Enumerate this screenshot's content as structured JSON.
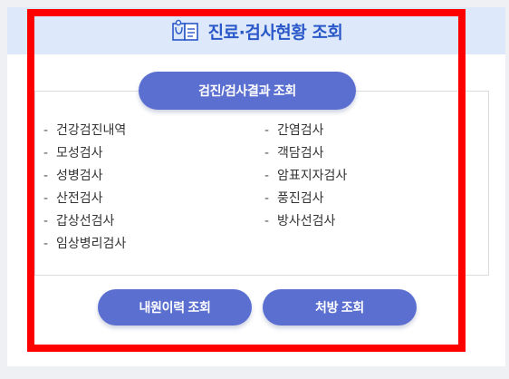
{
  "header": {
    "title": "진료·검사현황 조회",
    "icon": "clipboard-medical-icon"
  },
  "buttons": {
    "checkup_results": "검진/검사결과 조회",
    "visit_history": "내원이력 조회",
    "prescription": "처방 조회"
  },
  "left_items": [
    {
      "dash": "-",
      "label": "건강검진내역"
    },
    {
      "dash": "-",
      "label": "모성검사"
    },
    {
      "dash": "-",
      "label": "성병검사"
    },
    {
      "dash": "-",
      "label": "산전검사"
    },
    {
      "dash": "-",
      "label": "갑상선검사"
    },
    {
      "dash": "-",
      "label": "임상병리검사"
    }
  ],
  "right_items": [
    {
      "dash": "-",
      "label": "간염검사"
    },
    {
      "dash": "-",
      "label": "객담검사"
    },
    {
      "dash": "-",
      "label": "암표지자검사"
    },
    {
      "dash": "-",
      "label": "풍진검사"
    },
    {
      "dash": "-",
      "label": "방사선검사"
    }
  ],
  "colors": {
    "header_bg": "#dde9fb",
    "title": "#2a58c9",
    "button": "#5a6fd0",
    "highlight": "#ff0000"
  }
}
